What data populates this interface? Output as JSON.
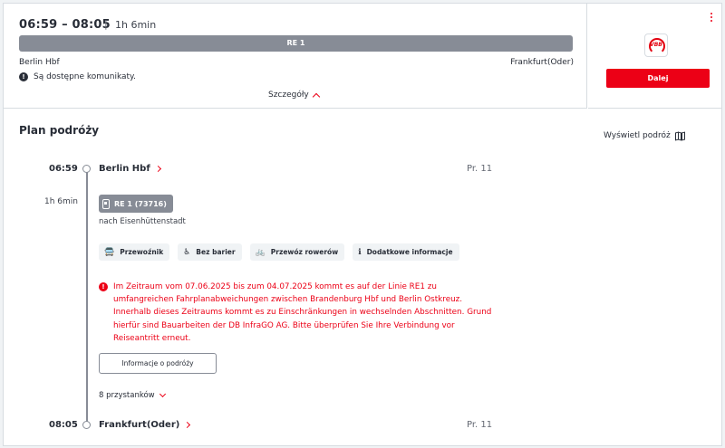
{
  "summary": {
    "times": "06:59 – 08:05",
    "separator": "|",
    "duration": "1h 6min",
    "line": "RE 1",
    "from": "Berlin Hbf",
    "to": "Frankfurt(Oder)",
    "notice": "Są dostępne komunikaty.",
    "details_label": "Szczegóły"
  },
  "side": {
    "operator_logo": "VBB",
    "next_label": "Dalej"
  },
  "plan": {
    "title": "Plan podróży",
    "show_journey_label": "Wyświetl podróż",
    "departure": {
      "time": "06:59",
      "station": "Berlin Hbf",
      "platform": "Pr. 11"
    },
    "segment": {
      "duration": "1h 6min",
      "train": "RE 1 (73716)",
      "direction": "nach Eisenhüttenstadt",
      "chips": [
        {
          "icon": "bus-icon",
          "glyph": "🚍",
          "label": "Przewoźnik"
        },
        {
          "icon": "accessibility-icon",
          "glyph": "♿",
          "label": "Bez barier"
        },
        {
          "icon": "bicycle-icon",
          "glyph": "🚲",
          "label": "Przewóz rowerów"
        },
        {
          "icon": "info-icon",
          "glyph": "ℹ",
          "label": "Dodatkowe informacje"
        }
      ],
      "warning": "Im Zeitraum vom 07.06.2025 bis zum 04.07.2025 kommt es auf der Linie RE1 zu umfangreichen Fahrplanabweichungen zwischen Brandenburg Hbf und Berlin Ostkreuz. Innerhalb dieses Zeitraums kommt es zu Einschränkungen in wechselnden Abschnitten. Grund hierfür sind Bauarbeiten der DB InfraGO AG. Bitte überprüfen Sie Ihre Verbindung vor Reiseantritt erneut.",
      "info_button": "Informacje o podróży",
      "stops_label": "8 przystanków"
    },
    "arrival": {
      "time": "08:05",
      "station": "Frankfurt(Oder)",
      "platform": "Pr. 11"
    }
  },
  "colors": {
    "accent": "#ec0016",
    "line_bar": "#878c96",
    "text": "#282d37"
  }
}
